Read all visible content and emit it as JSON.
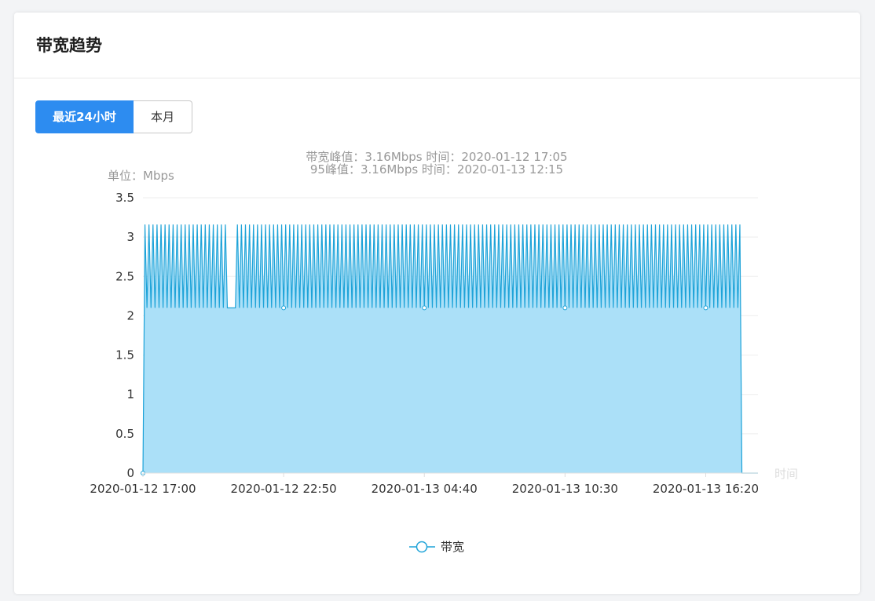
{
  "card": {
    "title": "带宽趋势"
  },
  "range_tabs": {
    "active_label": "最近24小时",
    "inactive_label": "本月"
  },
  "colors": {
    "accent": "#2d8cf0",
    "series_line": "#1ea3d8",
    "series_fill": "#a6def8",
    "grid": "#eeeeee"
  },
  "chart_data": {
    "type": "area",
    "subtitle_lines": [
      "带宽峰值：3.16Mbps 时间：2020-01-12 17:05",
      "95峰值：3.16Mbps 时间：2020-01-13 12:15"
    ],
    "y_unit_label": "单位：Mbps",
    "x_axis_name": "时间",
    "y_ticks": [
      "0",
      "0.5",
      "1",
      "1.5",
      "2",
      "2.5",
      "3",
      "3.5"
    ],
    "ylim": [
      0,
      3.5
    ],
    "x_tick_labels": [
      "2020-01-12 17:00",
      "2020-01-12 22:50",
      "2020-01-13 04:40",
      "2020-01-13 10:30",
      "2020-01-13 16:20"
    ],
    "x_range_minutes_from_first_label": [
      0,
      1530
    ],
    "x_tick_minutes_from_first_label": [
      0,
      350,
      700,
      1050,
      1400
    ],
    "series": [
      {
        "name": "带宽",
        "pattern": "alternating between peak and trough every 5 minutes",
        "start_value": 0,
        "peak": 3.16,
        "trough": 2.1,
        "flat_gap_minutes": [
          210,
          225
        ],
        "end_value": 0,
        "last_data_minute": 1485
      }
    ],
    "grid": true,
    "legend_position": "bottom-center"
  }
}
